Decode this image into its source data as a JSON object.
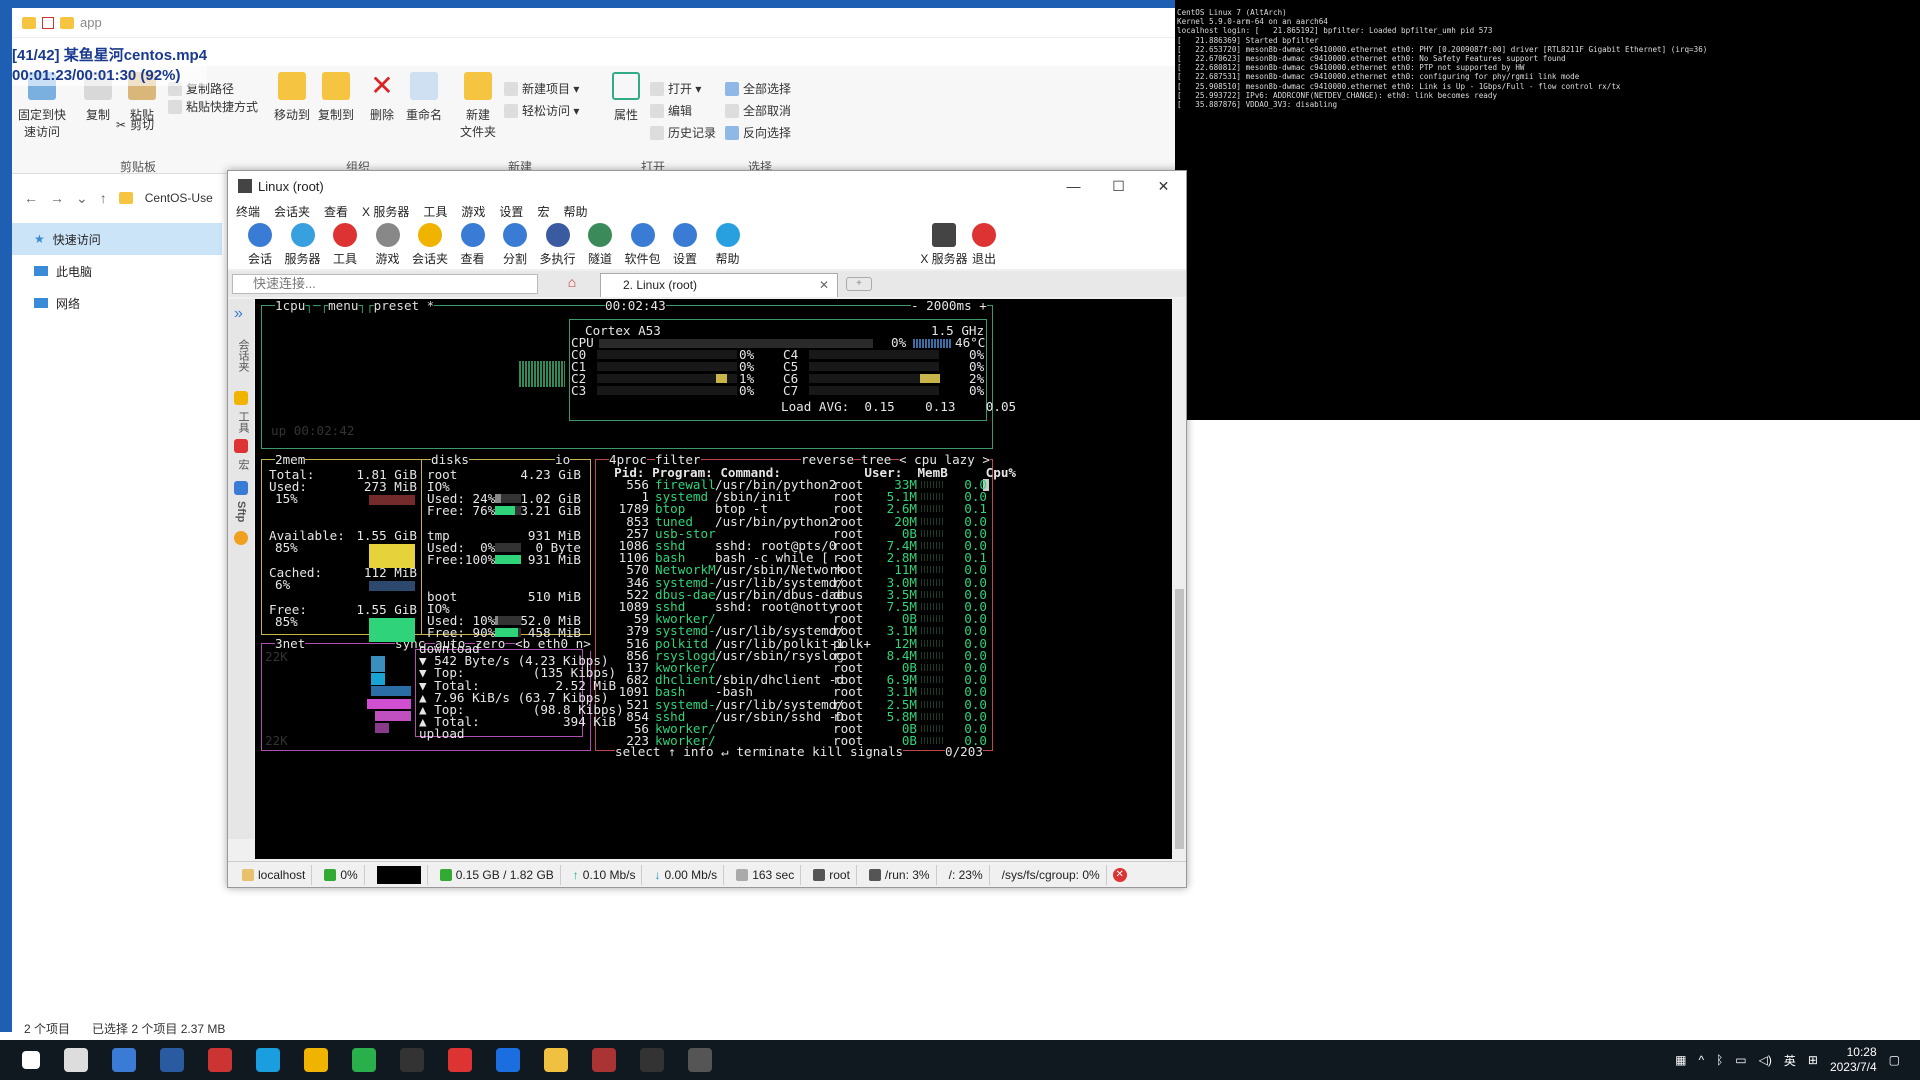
{
  "explorer": {
    "title": "app",
    "overlay_line1": "[41/42] 某鱼星河centos.mp4",
    "overlay_line2": "00:01:23/00:01:30 (92%)",
    "ribbon": {
      "pin": "固定到快\n速访问",
      "copy": "复制",
      "paste": "粘贴",
      "copy_path": "复制路径",
      "paste_shortcut": "粘贴快捷方式",
      "cut": "剪切",
      "move_to": "移动到",
      "copy_to": "复制到",
      "delete": "删除",
      "rename": "重命名",
      "new_folder": "新建\n文件夹",
      "new_item": "新建项目 ▾",
      "easy_access": "轻松访问 ▾",
      "properties": "属性",
      "open": "打开 ▾",
      "edit": "编辑",
      "history": "历史记录",
      "select_all": "全部选择",
      "select_none": "全部取消",
      "invert": "反向选择",
      "groups": {
        "clipboard": "剪贴板",
        "organize": "组织",
        "new": "新建",
        "open": "打开",
        "select": "选择"
      }
    },
    "address": "CentOS-Use",
    "nav": [
      "快速访问",
      "此电脑",
      "网络"
    ],
    "status": [
      "2 个项目",
      "已选择 2 个项目  2.37 MB"
    ]
  },
  "console_lines": [
    "CentOS Linux 7 (AltArch)",
    "Kernel 5.9.0-arm-64 on an aarch64",
    "",
    "localhost login: [   21.865192] bpfilter: Loaded bpfilter_umh pid 573",
    "[   21.886369] Started bpfilter",
    "[   22.653720] meson8b-dwmac c9410000.ethernet eth0: PHY [0.2009087f:00] driver [RTL8211F Gigabit Ethernet] (irq=36)",
    "[   22.670623] meson8b-dwmac c9410000.ethernet eth0: No Safety Features support found",
    "[   22.680812] meson8b-dwmac c9410000.ethernet eth0: PTP not supported by HW",
    "[   22.687531] meson8b-dwmac c9410000.ethernet eth0: configuring for phy/rgmii link mode",
    "[   25.908510] meson8b-dwmac c9410000.ethernet eth0: Link is Up - 1Gbps/Full - flow control rx/tx",
    "[   25.993722] IPv6: ADDRCONF(NETDEV_CHANGE): eth0: link becomes ready",
    "[   35.887876] VDDAO_3V3: disabling"
  ],
  "moba": {
    "title": "Linux (root)",
    "menu": [
      "终端",
      "会话夹",
      "查看",
      "X 服务器",
      "工具",
      "游戏",
      "设置",
      "宏",
      "帮助"
    ],
    "tools": [
      "会话",
      "服务器",
      "工具",
      "游戏",
      "会话夹",
      "查看",
      "分割",
      "多执行",
      "隧道",
      "软件包",
      "设置",
      "帮助"
    ],
    "xserver": "X 服务器",
    "exit": "退出",
    "quick_placeholder": "快速连接...",
    "tab_label": "2. Linux (root)",
    "side_labels": [
      "会话夹",
      "工具",
      "宏",
      "Sftp"
    ],
    "status": {
      "host": "localhost",
      "cpu": "0%",
      "mem": "0.15 GB / 1.82 GB",
      "up": "0.10 Mb/s",
      "down": "0.00 Mb/s",
      "uptime": "163 sec",
      "user": "root",
      "run": "/run: 3%",
      "root": "/: 23%",
      "cgroup": "/sys/fs/cgroup: 0%"
    }
  },
  "btop": {
    "cpu_header": {
      "tag": "1cpu",
      "menu": "menu",
      "preset": "preset *",
      "clock": "00:02:43",
      "rate": "- 2000ms +"
    },
    "model": "Cortex A53",
    "freq": "1.5 GHz",
    "cpu_total": "0%",
    "temp": "46°C",
    "cores": [
      {
        "name": "C0",
        "pct": "0%",
        "fill": 0.0
      },
      {
        "name": "C1",
        "pct": "0%",
        "fill": 0.0
      },
      {
        "name": "C2",
        "pct": "1%",
        "fill": 0.01
      },
      {
        "name": "C3",
        "pct": "0%",
        "fill": 0.0
      },
      {
        "name": "C4",
        "pct": "0%",
        "fill": 0.0
      },
      {
        "name": "C5",
        "pct": "0%",
        "fill": 0.0
      },
      {
        "name": "C6",
        "pct": "2%",
        "fill": 0.02
      },
      {
        "name": "C7",
        "pct": "0%",
        "fill": 0.0
      }
    ],
    "load": {
      "label": "Load AVG:",
      "v1": "0.15",
      "v5": "0.13",
      "v15": "0.05"
    },
    "uptime": "up 00:02:42",
    "mem": {
      "tag": "2mem",
      "disks_tag": "disks",
      "io": "io",
      "total": {
        "label": "Total:",
        "val": "1.81 GiB"
      },
      "used": {
        "label": "Used:",
        "val": "273 MiB",
        "pct": "15%"
      },
      "available": {
        "label": "Available:",
        "val": "1.55 GiB",
        "pct": "85%"
      },
      "cached": {
        "label": "Cached:",
        "val": "112 MiB",
        "pct": "6%"
      },
      "free": {
        "label": "Free:",
        "val": "1.55 GiB",
        "pct": "85%"
      }
    },
    "disks": [
      {
        "name": "root",
        "size": "4.23 GiB",
        "io": "IO%",
        "used_label": "Used: 24%",
        "used": "1.02 GiB",
        "free_label": "Free: 76%",
        "free": "3.21 GiB",
        "used_frac": 0.24,
        "free_frac": 0.76
      },
      {
        "name": "tmp",
        "size": "931 MiB",
        "io": "",
        "used_label": "Used:  0%",
        "used": "0 Byte",
        "free_label": "Free:100%",
        "free": "931 MiB",
        "used_frac": 0.0,
        "free_frac": 1.0
      },
      {
        "name": "boot",
        "size": "510 MiB",
        "io": "IO%",
        "used_label": "Used: 10%",
        "used": "52.0 MiB",
        "free_label": "Free: 90%",
        "free": "458 MiB",
        "used_frac": 0.1,
        "free_frac": 0.9
      }
    ],
    "net": {
      "tag": "3net",
      "sync": "sync",
      "auto": "auto",
      "zero": "zero",
      "iface": "<b eth0 n>",
      "scale_top": "22K",
      "scale_bot": "22K",
      "download": "download",
      "d_rate": "▼ 542 Byte/s (4.23 Kibps)",
      "d_top": "▼ Top:         (135 Kibps)",
      "d_total": "▼ Total:          2.52 MiB",
      "u_rate": "▲ 7.96 KiB/s (63.7 Kibps)",
      "u_top": "▲ Top:         (98.8 Kibps)",
      "u_total": "▲ Total:           394 KiB",
      "upload": "upload"
    },
    "proc": {
      "tag": "4proc",
      "filter": "filter",
      "reverse": "reverse",
      "tree": "tree",
      "sort": "< cpu lazy >",
      "header": "  Pid: Program: Command:           User:  MemB     Cpu%",
      "count": "0/203",
      "footer": "select ↑ info ↵ terminate kill signals",
      "rows": [
        [
          "556",
          "firewall",
          "/usr/bin/python2",
          "root",
          "33M",
          "0.0"
        ],
        [
          "1",
          "systemd",
          "/sbin/init",
          "root",
          "5.1M",
          "0.0"
        ],
        [
          "1789",
          "btop",
          "btop -t",
          "root",
          "2.6M",
          "0.1"
        ],
        [
          "853",
          "tuned",
          "/usr/bin/python2",
          "root",
          "20M",
          "0.0"
        ],
        [
          "257",
          "usb-stor",
          "",
          "root",
          "0B",
          "0.0"
        ],
        [
          "1086",
          "sshd",
          "sshd: root@pts/0",
          "root",
          "7.4M",
          "0.0"
        ],
        [
          "1106",
          "bash",
          "bash -c while [ -",
          "root",
          "2.8M",
          "0.1"
        ],
        [
          "570",
          "NetworkM",
          "/usr/sbin/Network",
          "root",
          "11M",
          "0.0"
        ],
        [
          "346",
          "systemd-",
          "/usr/lib/systemd/",
          "root",
          "3.0M",
          "0.0"
        ],
        [
          "522",
          "dbus-dae",
          "/usr/bin/dbus-dae",
          "dbus",
          "3.5M",
          "0.0"
        ],
        [
          "1089",
          "sshd",
          "sshd: root@notty",
          "root",
          "7.5M",
          "0.0"
        ],
        [
          "59",
          "kworker/",
          "",
          "root",
          "0B",
          "0.0"
        ],
        [
          "379",
          "systemd-",
          "/usr/lib/systemd/",
          "root",
          "3.1M",
          "0.0"
        ],
        [
          "516",
          "polkitd",
          "/usr/lib/polkit-1",
          "polk+",
          "12M",
          "0.0"
        ],
        [
          "856",
          "rsyslogd",
          "/usr/sbin/rsyslog",
          "root",
          "8.4M",
          "0.0"
        ],
        [
          "137",
          "kworker/",
          "",
          "root",
          "0B",
          "0.0"
        ],
        [
          "682",
          "dhclient",
          "/sbin/dhclient -d",
          "root",
          "6.9M",
          "0.0"
        ],
        [
          "1091",
          "bash",
          "-bash",
          "root",
          "3.1M",
          "0.0"
        ],
        [
          "521",
          "systemd-",
          "/usr/lib/systemd/",
          "root",
          "2.5M",
          "0.0"
        ],
        [
          "854",
          "sshd",
          "/usr/sbin/sshd -D",
          "root",
          "5.8M",
          "0.0"
        ],
        [
          "56",
          "kworker/",
          "",
          "root",
          "0B",
          "0.0"
        ],
        [
          "223",
          "kworker/",
          "",
          "root",
          "0B",
          "0.0"
        ]
      ]
    }
  },
  "taskbar": {
    "time": "10:28",
    "date": "2023/7/4",
    "ime": "英",
    "apps": [
      "start",
      "app1",
      "app2",
      "app3",
      "app4",
      "edge",
      "chrome",
      "wechat",
      "app5",
      "app6",
      "bing",
      "explorer",
      "app7",
      "app8",
      "mobaxterm"
    ]
  },
  "colors": {
    "cpu_box": "#3c9a6a",
    "mem_box": "#c8b44a",
    "net_box": "#b04fb0",
    "proc_box": "#c04848",
    "green": "#2fd37a",
    "yellow": "#e6d23a",
    "magenta": "#d04fd0"
  }
}
